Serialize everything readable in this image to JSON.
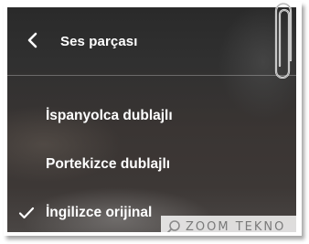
{
  "menu": {
    "title": "Ses parçası",
    "back_icon": "chevron-left-icon",
    "items": [
      {
        "label": "İspanyolca dublajlı",
        "selected": false
      },
      {
        "label": "Portekizce dublajlı",
        "selected": false
      },
      {
        "label": "İngilizce orijinal",
        "selected": true
      }
    ]
  },
  "watermark": {
    "text": "ZOOM TEKNO",
    "icon": "magnifier-icon"
  },
  "colors": {
    "text": "#ffffff",
    "background": "#333030"
  }
}
